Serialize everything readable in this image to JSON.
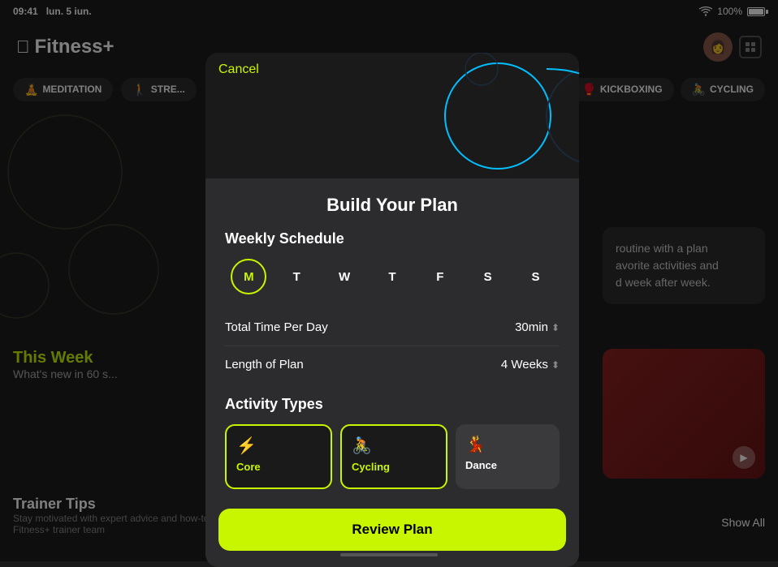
{
  "statusBar": {
    "time": "09:41",
    "date": "lun. 5 iun.",
    "battery": "100%"
  },
  "fitnessApp": {
    "logo": "Fitness+",
    "categoryTabs": [
      {
        "id": "meditation",
        "label": "MEDITATION",
        "icon": "🧘"
      },
      {
        "id": "strength",
        "label": "STRE...",
        "icon": "🚶"
      }
    ],
    "sportTabsRight": [
      {
        "id": "kickboxing",
        "label": "KICKBOXING",
        "icon": "🥊"
      },
      {
        "id": "cycling",
        "label": "CYCLING",
        "icon": "🚴"
      }
    ],
    "thisWeek": {
      "title": "This Week",
      "subtitle": "What's new in 60 s..."
    },
    "trainerTips": {
      "title": "Trainer Tips",
      "subtitle": "Stay motivated with expert advice and how-to demos from the Fitness+ trainer team"
    },
    "showAll": "Show All",
    "rightCard": {
      "text": "routine with a plan\navorite activities and\nd week after week."
    }
  },
  "modal": {
    "cancel": "Cancel",
    "title": "Build Your Plan",
    "weeklySchedule": {
      "label": "Weekly Schedule",
      "days": [
        "M",
        "T",
        "W",
        "T",
        "F",
        "S",
        "S"
      ],
      "activeDay": 0
    },
    "totalTimePerDay": {
      "label": "Total Time Per Day",
      "value": "30min",
      "hasChevron": true
    },
    "lengthOfPlan": {
      "label": "Length of Plan",
      "value": "4 Weeks",
      "hasChevron": true
    },
    "activityTypes": {
      "label": "Activity Types",
      "items": [
        {
          "id": "core",
          "icon": "⚡",
          "label": "Core",
          "selected": true
        },
        {
          "id": "cycling",
          "icon": "🚴",
          "label": "Cycling",
          "selected": true
        },
        {
          "id": "dance",
          "icon": "💃",
          "label": "Dance",
          "selected": false
        }
      ]
    },
    "reviewButton": "Review Plan"
  }
}
